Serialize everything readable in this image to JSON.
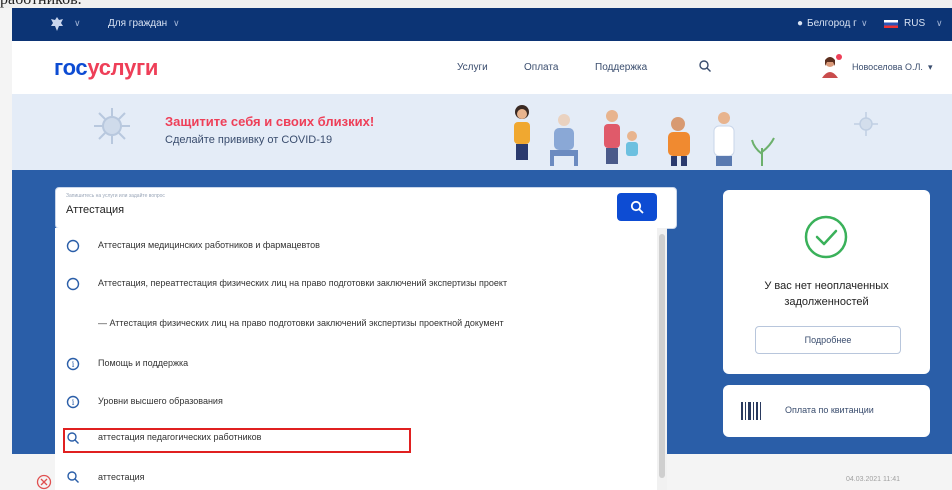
{
  "doc_fragment": "работников.",
  "topbar": {
    "audience_label": "Для граждан",
    "location_label": "Белгород г",
    "language_label": "RUS"
  },
  "header": {
    "logo_part1": "гос",
    "logo_part2": "услуги",
    "nav": [
      "Услуги",
      "Оплата",
      "Поддержка"
    ],
    "user_name": "Новоселова О.Л."
  },
  "banner": {
    "title": "Защитите себя и своих близких!",
    "subtitle": "Сделайте прививку от COVID-19"
  },
  "search": {
    "label": "Запишитесь на услуги или задайте вопрос",
    "value": "Аттестация"
  },
  "dropdown": {
    "items": [
      {
        "icon": "radio-circle-icon",
        "text": "Аттестация медицинских работников и фармацевтов"
      },
      {
        "icon": "radio-circle-icon",
        "text": "Аттестация, переаттестация физических лиц на право подготовки заключений экспертизы проект"
      },
      {
        "icon": "dash-icon",
        "text": "— Аттестация физических лиц на право подготовки заключений экспертизы проектной документ"
      },
      {
        "icon": "info-icon",
        "text": "Помощь и поддержка"
      },
      {
        "icon": "info-icon",
        "text": "Уровни высшего образования"
      },
      {
        "icon": "search-icon",
        "text": "аттестация педагогических работников"
      },
      {
        "icon": "search-icon",
        "text": "аттестация"
      }
    ]
  },
  "debt_card": {
    "line1": "У вас нет неоплаченных",
    "line2": "задолженностей",
    "button_label": "Подробнее"
  },
  "receipt_card": {
    "label": "Оплата по квитанции"
  },
  "footer": {
    "timestamp": "04.03.2021 11:41"
  },
  "colors": {
    "brand_blue": "#0d4cd3",
    "brand_red": "#ee3f58",
    "topbar": "#0c3475",
    "main_blue": "#2a5ea8",
    "highlight": "#e02020"
  }
}
